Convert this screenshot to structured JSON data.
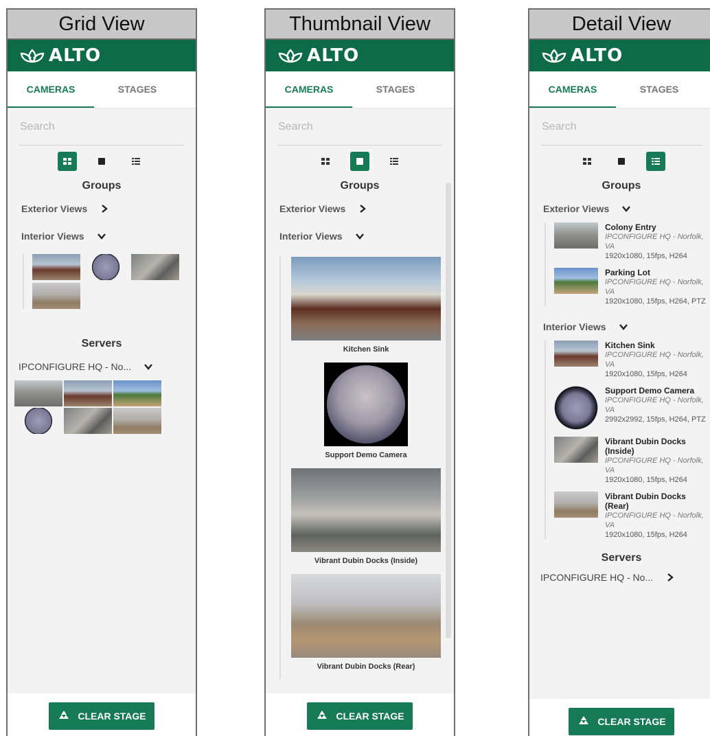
{
  "app": {
    "logo_text": "ALTO",
    "accent": "#0e6b47"
  },
  "panels": [
    {
      "caption": "Grid View"
    },
    {
      "caption": "Thumbnail View"
    },
    {
      "caption": "Detail View"
    }
  ],
  "tabs": {
    "cameras": "CAMERAS",
    "stages": "STAGES"
  },
  "search": {
    "placeholder": "Search"
  },
  "sections": {
    "groups": "Groups",
    "servers": "Servers"
  },
  "groups": {
    "exterior": "Exterior Views",
    "interior": "Interior Views"
  },
  "server": {
    "name": "IPCONFIGURE HQ - No..."
  },
  "cameras": [
    {
      "name": "Kitchen Sink",
      "location": "IPCONFIGURE HQ - Norfolk, VA",
      "spec": "1920x1080, 15fps, H264"
    },
    {
      "name": "Support Demo Camera",
      "location": "IPCONFIGURE HQ - Norfolk, VA",
      "spec": "2992x2992, 15fps, H264, PTZ"
    },
    {
      "name": "Vibrant Dubin Docks (Inside)",
      "location": "IPCONFIGURE HQ - Norfolk, VA",
      "spec": "1920x1080, 15fps, H264"
    },
    {
      "name": "Vibrant Dubin Docks (Rear)",
      "location": "IPCONFIGURE HQ - Norfolk, VA",
      "spec": "1920x1080, 15fps, H264"
    }
  ],
  "exterior_cameras": [
    {
      "name": "Colony Entry",
      "location": "IPCONFIGURE HQ - Norfolk, VA",
      "spec": "1920x1080, 15fps, H264"
    },
    {
      "name": "Parking Lot",
      "location": "IPCONFIGURE HQ - Norfolk, VA",
      "spec": "1920x1080, 15fps, H264, PTZ"
    }
  ],
  "footer": {
    "clear_label": "CLEAR STAGE"
  }
}
